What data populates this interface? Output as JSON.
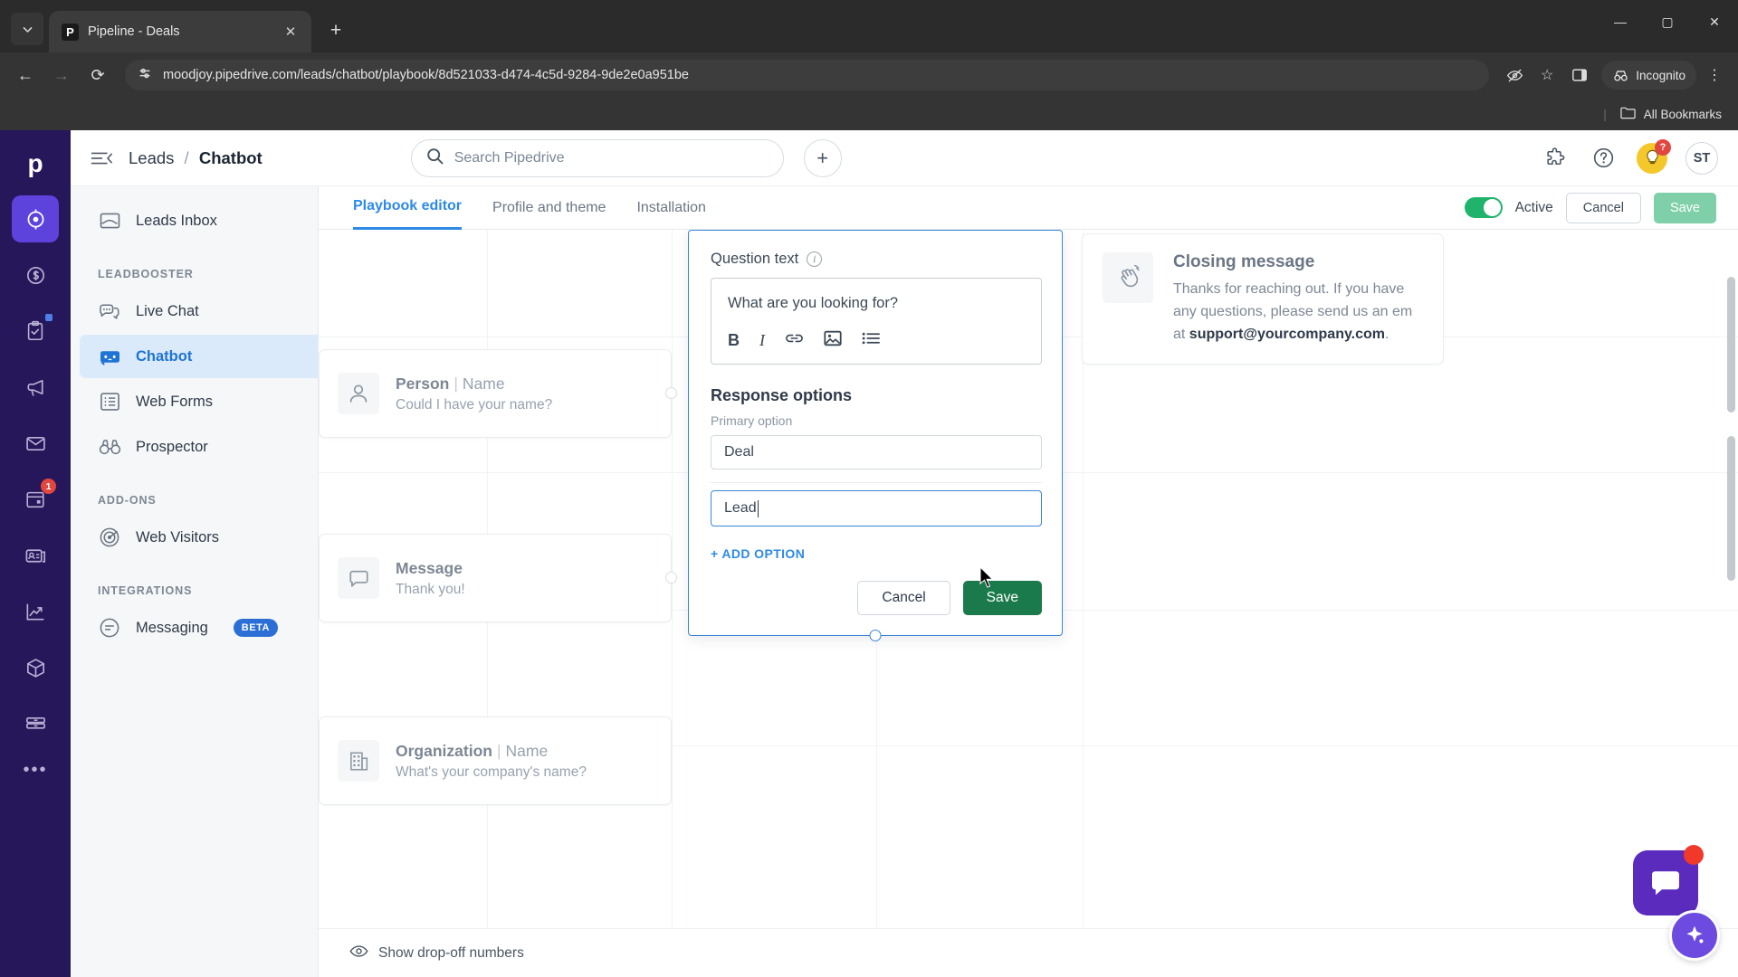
{
  "browser": {
    "tab": {
      "title": "Pipeline - Deals",
      "favicon_letter": "P",
      "close_icon": "✕"
    },
    "tab_list_icon": "chevron-down",
    "new_tab_icon": "+",
    "window": {
      "minimize": "—",
      "maximize": "▢",
      "close": "✕"
    },
    "nav": {
      "back": "←",
      "forward": "→",
      "reload": "⟳"
    },
    "url": "moodjoy.pipedrive.com/leads/chatbot/playbook/8d521033-d474-4c5d-9284-9de2e0a951be",
    "site_info_icon": "page-settings-icon",
    "omni": {
      "eye_icon": "eye-off-icon",
      "star_icon": "☆",
      "panel_icon": "side-panel-icon",
      "menu_icon": "⋮"
    },
    "incognito_label": "Incognito",
    "bookmarks": {
      "divider": "|",
      "label": "All Bookmarks",
      "folder_icon": "folder-icon"
    }
  },
  "rail": {
    "logo": "p",
    "items": [
      {
        "name": "leads",
        "icon": "target-icon",
        "active": true,
        "badge": ""
      },
      {
        "name": "deals",
        "icon": "dollar-icon",
        "active": false,
        "badge": ""
      },
      {
        "name": "activities",
        "icon": "clipboard-check-icon",
        "active": false,
        "badge": "",
        "dot": true
      },
      {
        "name": "campaigns",
        "icon": "megaphone-icon",
        "active": false,
        "badge": ""
      },
      {
        "name": "mail",
        "icon": "envelope-icon",
        "active": false,
        "badge": ""
      },
      {
        "name": "calendar",
        "icon": "calendar-icon",
        "active": false,
        "badge": "1"
      },
      {
        "name": "contacts",
        "icon": "contact-card-icon",
        "active": false,
        "badge": ""
      },
      {
        "name": "insights",
        "icon": "trend-chart-icon",
        "active": false,
        "badge": ""
      },
      {
        "name": "products",
        "icon": "box-icon",
        "active": false,
        "badge": ""
      },
      {
        "name": "marketplace",
        "icon": "drawer-icon",
        "active": false,
        "badge": ""
      }
    ],
    "more": "•••"
  },
  "topbar": {
    "collapse_icon": "collapse-sidebar-icon",
    "breadcrumb": {
      "parent": "Leads",
      "separator": "/",
      "current": "Chatbot"
    },
    "search": {
      "placeholder": "Search Pipedrive",
      "icon": "search-icon"
    },
    "add_icon": "+",
    "right_icons": [
      {
        "name": "apps-icon",
        "glyph": "puzzle"
      },
      {
        "name": "help-icon",
        "glyph": "?"
      },
      {
        "name": "tips-icon",
        "glyph": "bulb",
        "badge": "?"
      }
    ],
    "avatar_initials": "ST"
  },
  "sidenav": {
    "top_items": [
      {
        "label": "Leads Inbox",
        "icon": "inbox-icon"
      }
    ],
    "sections": [
      {
        "title": "LEADBOOSTER",
        "items": [
          {
            "label": "Live Chat",
            "icon": "chat-bubbles-icon",
            "active": false
          },
          {
            "label": "Chatbot",
            "icon": "robot-icon",
            "active": true
          },
          {
            "label": "Web Forms",
            "icon": "form-list-icon",
            "active": false
          },
          {
            "label": "Prospector",
            "icon": "binoculars-icon",
            "active": false
          }
        ]
      },
      {
        "title": "ADD-ONS",
        "items": [
          {
            "label": "Web Visitors",
            "icon": "radar-icon",
            "active": false
          }
        ]
      },
      {
        "title": "INTEGRATIONS",
        "items": [
          {
            "label": "Messaging",
            "icon": "message-lines-icon",
            "active": false,
            "tag": "BETA"
          }
        ]
      }
    ]
  },
  "editor": {
    "tabs": [
      {
        "label": "Playbook editor",
        "selected": true
      },
      {
        "label": "Profile and theme",
        "selected": false
      },
      {
        "label": "Installation",
        "selected": false
      }
    ],
    "toggle_label": "Active",
    "cancel_label": "Cancel",
    "save_label": "Save"
  },
  "nodes": [
    {
      "name": "person-name",
      "title": "Person",
      "separator": "|",
      "subtitle_strong": "Name",
      "text": "Could I have your name?",
      "icon": "person-icon"
    },
    {
      "name": "message",
      "title": "Message",
      "separator": "",
      "subtitle_strong": "",
      "text": "Thank you!",
      "icon": "speech-bubble-icon"
    },
    {
      "name": "organization-name",
      "title": "Organization",
      "separator": "|",
      "subtitle_strong": "Name",
      "text": "What's your company's name?",
      "icon": "building-icon"
    }
  ],
  "panel": {
    "question_label": "Question text",
    "info_icon": "info-icon",
    "question_value": "What are you looking for?",
    "toolbar": [
      {
        "name": "bold-icon",
        "glyph": "B"
      },
      {
        "name": "italic-icon",
        "glyph": "I"
      },
      {
        "name": "link-icon",
        "glyph": "link"
      },
      {
        "name": "image-icon",
        "glyph": "image"
      },
      {
        "name": "bullet-list-icon",
        "glyph": "list"
      }
    ],
    "response_options_title": "Response options",
    "primary_option_label": "Primary option",
    "options": [
      {
        "value": "Deal",
        "focused": false
      },
      {
        "value": "Lead",
        "focused": true
      }
    ],
    "add_option_label": "+ ADD OPTION",
    "cancel_label": "Cancel",
    "save_label": "Save"
  },
  "closing_card": {
    "icon": "waving-hand-icon",
    "title": "Closing message",
    "line1": "Thanks for reaching out. If you have",
    "line2": "any questions, please send us an em",
    "line3_prefix": "at ",
    "line3_strong": "support@yourcompany.com",
    "line3_suffix": "."
  },
  "statusbar": {
    "eye_icon": "eye-icon",
    "label": "Show drop-off numbers"
  },
  "widgets": {
    "chat_icon": "chat-widget-icon",
    "assistant_icon": "sparkle-icon"
  },
  "colors": {
    "rail_bg": "#26175a",
    "accent_purple": "#5d43dc",
    "link_blue": "#2e8ae6",
    "active_nav_bg": "#dbeafb",
    "save_green": "#1b7a4b",
    "toggle_green": "#1fb36b",
    "badge_red": "#e2473f",
    "panel_border": "#3a86d8"
  }
}
